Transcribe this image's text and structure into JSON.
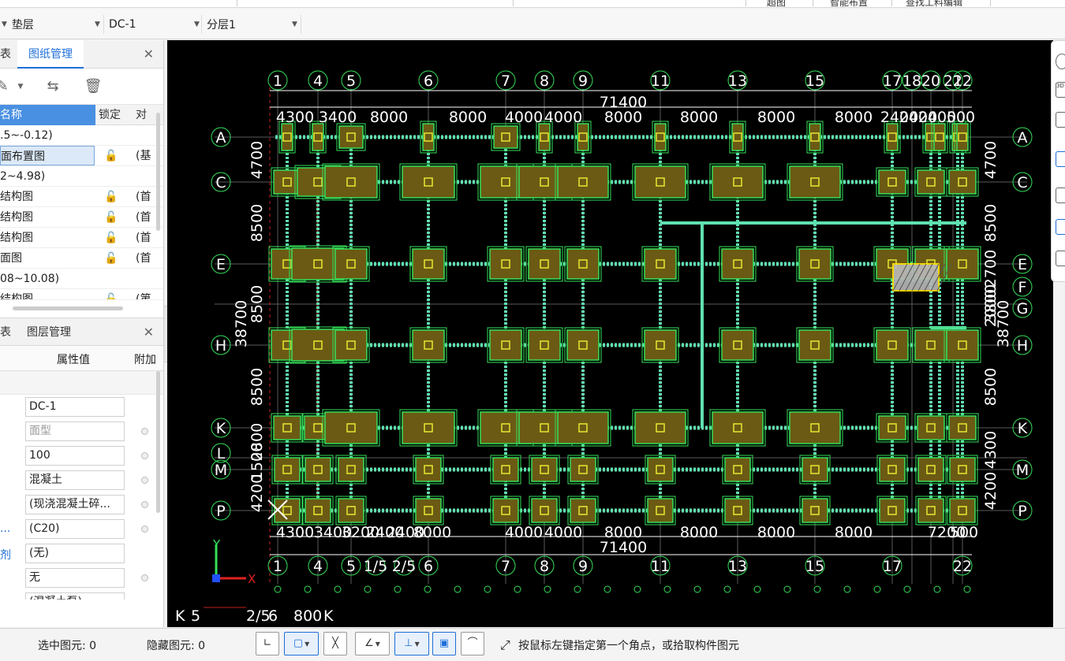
{
  "top_buttons": [
    "超图",
    "智能布置",
    "查找工料编辑"
  ],
  "toolbar": {
    "combos": [
      {
        "value": "垫层"
      },
      {
        "value": "DC-1"
      },
      {
        "value": "分层1"
      }
    ]
  },
  "drawing_panel": {
    "tabs": [
      "表",
      "图纸管理"
    ],
    "columns": [
      "名称",
      "锁定",
      "对"
    ],
    "rows": [
      {
        "name": ".5~-0.12)",
        "group": true
      },
      {
        "name": "面布置图",
        "lock": true,
        "floor": "(基",
        "selected": true
      },
      {
        "name": "2~4.98)",
        "group": true
      },
      {
        "name": "结构图",
        "lock": true,
        "floor": "(首"
      },
      {
        "name": "结构图",
        "lock": true,
        "floor": "(首"
      },
      {
        "name": "结构图",
        "lock": true,
        "floor": "(首"
      },
      {
        "name": "面图",
        "lock": true,
        "floor": "(首"
      },
      {
        "name": "08~10.08)",
        "group": true
      },
      {
        "name": "结构图",
        "lock": true,
        "floor": "(第"
      }
    ]
  },
  "property_panel": {
    "tabs": [
      "表",
      "图层管理"
    ],
    "columns": [
      "属性值",
      "附加"
    ],
    "rows": [
      {
        "label": "",
        "value": "DC-1",
        "gray": false,
        "dot": false
      },
      {
        "label": "",
        "value": "面型",
        "gray": true,
        "dot": true
      },
      {
        "label": "",
        "value": "100",
        "gray": false,
        "dot": true
      },
      {
        "label": "",
        "value": "混凝土",
        "gray": false,
        "dot": true
      },
      {
        "label": "",
        "value": "(现浇混凝土碎...",
        "gray": false,
        "dot": true
      },
      {
        "label": "...",
        "value": "(C20)",
        "gray": false,
        "dot": true
      },
      {
        "label": "剂",
        "value": "(无)",
        "gray": false,
        "dot": false,
        "blue": true
      },
      {
        "label": "",
        "value": "无",
        "gray": false,
        "dot": true
      },
      {
        "label": "",
        "value": "(混凝土泵)",
        "gray": false,
        "dot": false
      }
    ]
  },
  "cad": {
    "top_axes": [
      "1",
      "4",
      "5",
      "6",
      "7",
      "8",
      "9",
      "11",
      "13",
      "15",
      "17",
      "18",
      "20",
      "21",
      "22"
    ],
    "top_dims": [
      "4300",
      "3400",
      "8000",
      "8000",
      "4000",
      "4000",
      "8000",
      "8000",
      "8000",
      "8000",
      "2400",
      "2400",
      "2400",
      "500"
    ],
    "top_total": "71400",
    "bottom_axes": [
      "1",
      "4",
      "5",
      "1/5",
      "2/5",
      "6",
      "7",
      "8",
      "9",
      "11",
      "13",
      "15",
      "17",
      "22"
    ],
    "bottom_dims": [
      "4300",
      "3400",
      "3200",
      "2400",
      "2400",
      "8000",
      "4000",
      "4000",
      "8000",
      "8000",
      "8000",
      "8000",
      "7200",
      "500"
    ],
    "bottom_total": "71400",
    "left_rows": [
      "A",
      "C",
      "E",
      "H",
      "K",
      "L",
      "M",
      "P"
    ],
    "right_rows": [
      "A",
      "C",
      "E",
      "F",
      "G",
      "H",
      "K",
      "M",
      "P"
    ],
    "left_dims": [
      "4700",
      "8500",
      "8500",
      "8500",
      "2800",
      "1500",
      "4200"
    ],
    "left_total": "38700",
    "right_dims": [
      "4700",
      "8500",
      "2700",
      "3800",
      "2000",
      "8500",
      "4300",
      "4200"
    ],
    "right_total": "38700",
    "mini_labels": [
      "K",
      "5",
      "2/5",
      "6",
      "800",
      "K"
    ],
    "ucs_y": "Y",
    "ucs_x": "X"
  },
  "statusbar": {
    "selected_label": "选中图元: 0",
    "hidden_label": "隐藏图元: 0",
    "hint": "按鼠标左键指定第一个角点，或拾取构件图元"
  }
}
